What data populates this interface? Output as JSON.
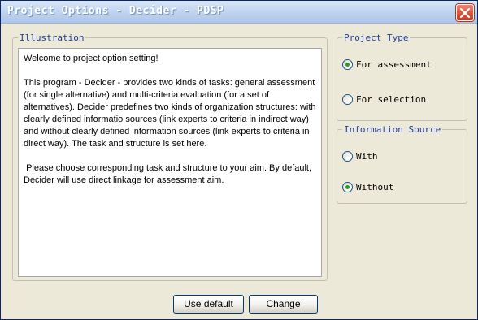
{
  "window": {
    "title": "Project Options - Decider - PDSP",
    "close_icon": "close-icon"
  },
  "illustration": {
    "legend": "Illustration",
    "paragraphs": [
      "Welcome to project option setting!",
      "This program - Decider - provides two kinds of tasks: general assessment (for single alternative) and multi-criteria evaluation (for a set of alternatives). Decider predefines two kinds of organization structures: with clearly defined informatio sources (link experts to criteria in indirect way) and without clearly defined information sources (link experts to criteria in direct way). The task and structure is set here.",
      " Please choose corresponding task and structure to your aim. By default, Decider will use direct linkage for assessment aim."
    ]
  },
  "project_type": {
    "legend": "Project Type",
    "options": [
      {
        "label": "For assessment",
        "checked": true
      },
      {
        "label": "For selection",
        "checked": false
      }
    ]
  },
  "information_source": {
    "legend": "Information Source",
    "options": [
      {
        "label": "With",
        "checked": false
      },
      {
        "label": "Without",
        "checked": true
      }
    ]
  },
  "buttons": {
    "use_default": "Use default",
    "change": "Change"
  }
}
